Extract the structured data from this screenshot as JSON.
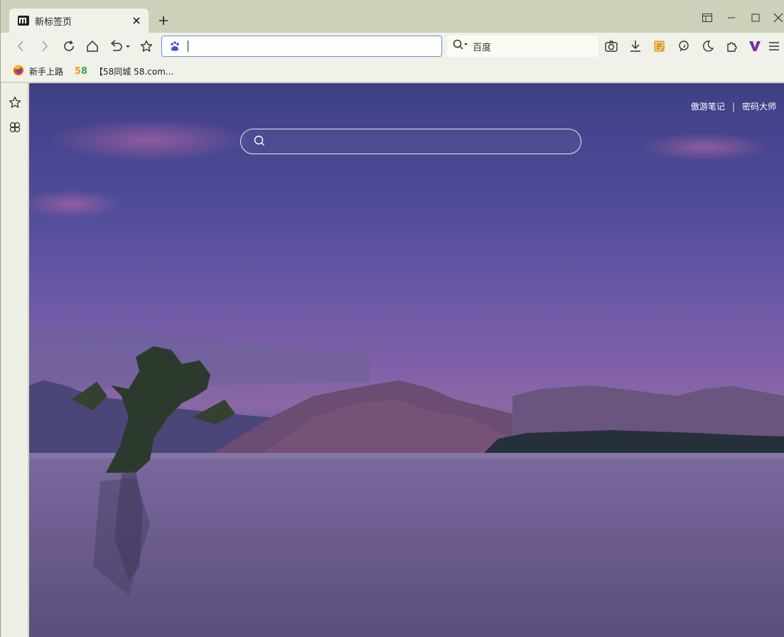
{
  "tab": {
    "title": "新标签页"
  },
  "toolbar": {
    "search_engine": "百度"
  },
  "bookmarks": [
    {
      "label": "新手上路"
    },
    {
      "label": "【58同城 58.com..."
    }
  ],
  "newtab": {
    "quick_links": [
      "傲游笔记",
      "密码大师"
    ],
    "separator": "|"
  },
  "colors": {
    "chrome": "#ccd2b9",
    "toolbar": "#f0f1e8",
    "url_focus_border": "#6b8fd6",
    "accent_violet": "#7b2ea8"
  },
  "icons": [
    "maxthon-logo-icon",
    "close-icon",
    "plus-icon",
    "back-icon",
    "forward-icon",
    "reload-icon",
    "home-icon",
    "undo-icon",
    "star-icon",
    "baidu-paw-icon",
    "search-icon",
    "camera-icon",
    "download-icon",
    "notes-icon",
    "ai-icon",
    "moon-icon",
    "extensions-icon",
    "v-icon",
    "menu-icon"
  ]
}
